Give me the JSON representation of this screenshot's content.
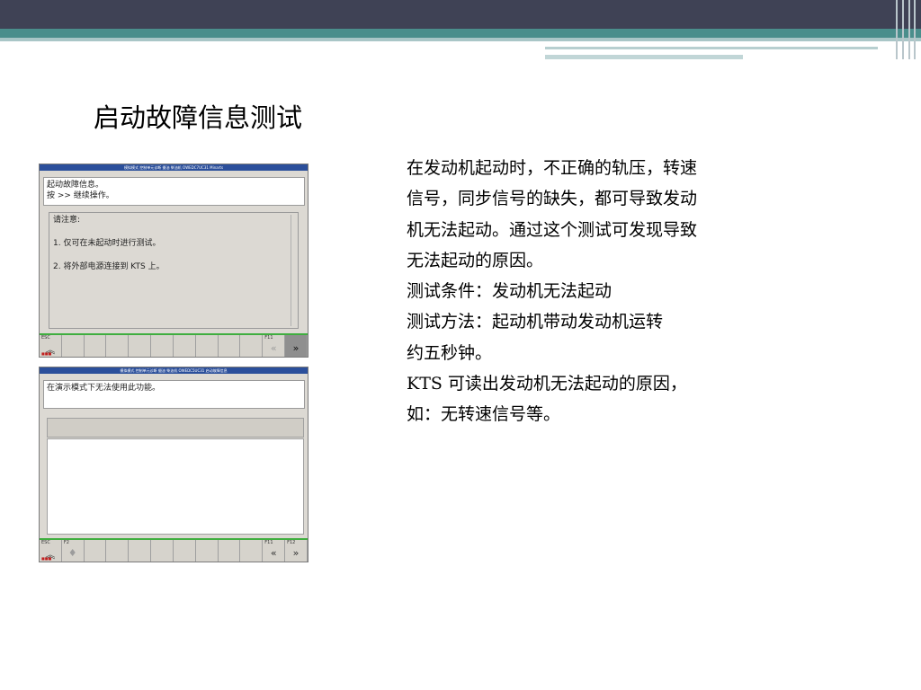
{
  "slide": {
    "title": "启动故障信息测试",
    "description_lines": [
      "在发动机起动时，不正确的轨压，转速",
      "信号，同步信号的缺失，都可导致发动",
      "机无法起动。通过这个测试可发现导致",
      "无法起动的原因。",
      "测试条件：发动机无法起动",
      "测试方法：起动机带动发动机运转",
      "约五秒钟。",
      "KTS 可读出发动机无法起动的原因，",
      "如：无转速信号等。"
    ]
  },
  "screen1": {
    "title_bar": "模拟模式 控制单元诊断 摄油 柴油机 OWEDC7UC31 Minarts",
    "message_lines": [
      "起动故障信息。",
      "按 >> 继续操作。"
    ],
    "note_title": "请注意:",
    "note_items": [
      "1. 仅可在未起动时进行测试。",
      "2. 将外部电源连接到 KTS 上。"
    ],
    "toolbar": {
      "esc_label": "ESC",
      "f11_label": "F11",
      "prev_icon": "double-chevron-left",
      "next_icon": "double-chevron-right",
      "up_icon": "double-chevron-up"
    }
  },
  "screen2": {
    "title_bar": "模拟模式 控制单元诊断 摄油 柴油机 OWEDC5UC31 启动故障信息",
    "message": "在演示模式下无法使用此功能。",
    "toolbar": {
      "esc_label": "ESC",
      "f2_label": "F2",
      "f11_label": "F11",
      "f12_label": "F12"
    }
  },
  "colors": {
    "header_dark": "#3f4255",
    "header_teal": "#4a8e8c",
    "screen_title_bar": "#2b4f9b",
    "toolbar_green": "#3fae3f"
  }
}
